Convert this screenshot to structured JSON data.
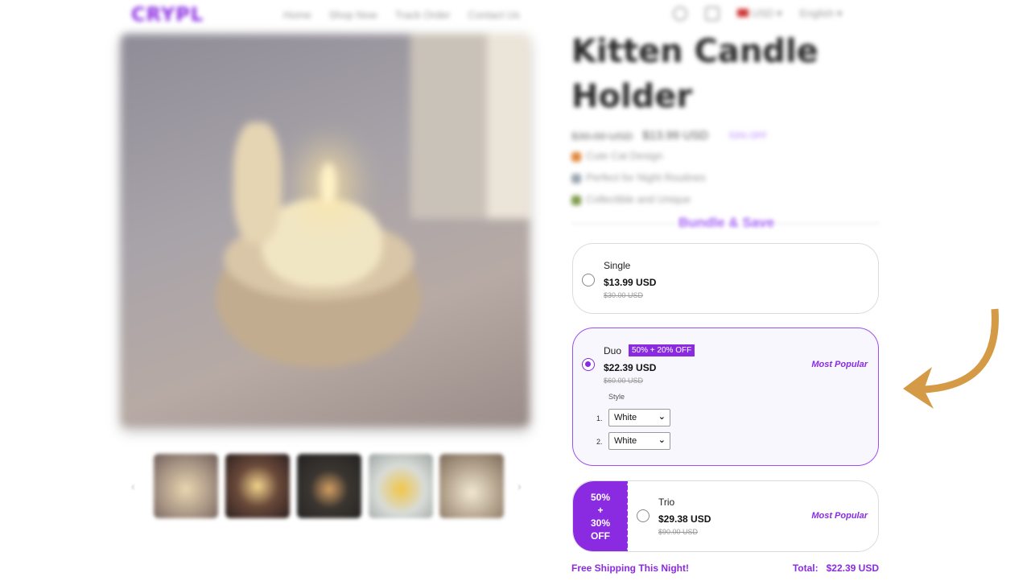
{
  "header": {
    "logo": "CRYPL",
    "nav": [
      "Home",
      "Shop Now",
      "Track Order",
      "Contact Us"
    ],
    "currency": "USD",
    "language": "English"
  },
  "product": {
    "title": "Kitten Candle Holder",
    "old_price": "$30.00 USD",
    "price": "$13.99 USD",
    "discount": "53% OFF",
    "features": [
      "Cute Cat Design",
      "Perfect for Night Routines",
      "Collectible and Unique"
    ]
  },
  "bundle": {
    "heading": "Bundle & Save",
    "options": [
      {
        "name": "Single",
        "price": "$13.99 USD",
        "old_price": "$30.00 USD"
      },
      {
        "name": "Duo",
        "badge": "50% + 20% OFF",
        "price": "$22.39 USD",
        "old_price": "$60.00 USD",
        "popular": "Most Popular",
        "style_label": "Style",
        "selects": [
          {
            "index": "1.",
            "value": "White"
          },
          {
            "index": "2.",
            "value": "White"
          }
        ]
      },
      {
        "name": "Trio",
        "tag": [
          "50%",
          "+",
          "30%",
          "OFF"
        ],
        "price": "$29.38 USD",
        "old_price": "$90.00 USD",
        "popular": "Most Popular"
      }
    ]
  },
  "footer": {
    "shipping": "Free Shipping This Night!",
    "total_label": "Total:",
    "total_value": "$22.39 USD"
  },
  "colors": {
    "accent": "#8a2be2",
    "arrow": "#d59a45"
  }
}
